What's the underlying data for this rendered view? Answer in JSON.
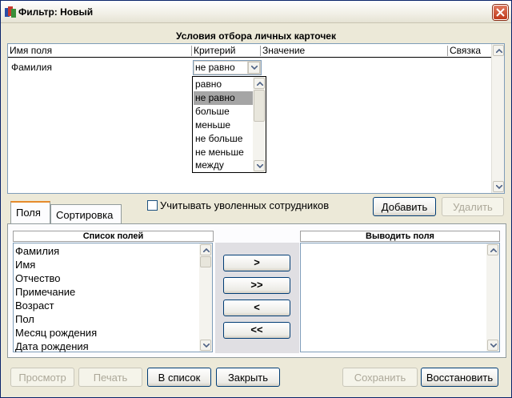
{
  "window": {
    "title": "Фильтр: Новый"
  },
  "conditions": {
    "title": "Условия отбора личных карточек",
    "columns": [
      "Имя поля",
      "Критерий",
      "Значение",
      "Связка"
    ],
    "rows": [
      {
        "field": "Фамилия",
        "criterion": "не равно"
      }
    ]
  },
  "dropdown": {
    "options": [
      "равно",
      "не равно",
      "больше",
      "меньше",
      "не больше",
      "не меньше",
      "между"
    ],
    "selected": "не равно"
  },
  "tabs": [
    "Поля",
    "Сортировка"
  ],
  "include_fired": {
    "label": "Учитывать уволенных сотрудников",
    "checked": false
  },
  "buttons": {
    "add": "Добавить",
    "delete": "Удалить",
    "preview": "Просмотр",
    "print": "Печать",
    "to_list": "В список",
    "close": "Закрыть",
    "save": "Сохранить",
    "restore": "Восстановить"
  },
  "fields_list": {
    "header": "Список полей",
    "items": [
      "Фамилия",
      "Имя",
      "Отчество",
      "Примечание",
      "Возраст",
      "Пол",
      "Месяц рождения",
      "Дата рождения"
    ]
  },
  "output_list": {
    "header": "Выводить поля",
    "items": []
  },
  "move_buttons": [
    ">",
    ">>",
    "<",
    "<<"
  ]
}
